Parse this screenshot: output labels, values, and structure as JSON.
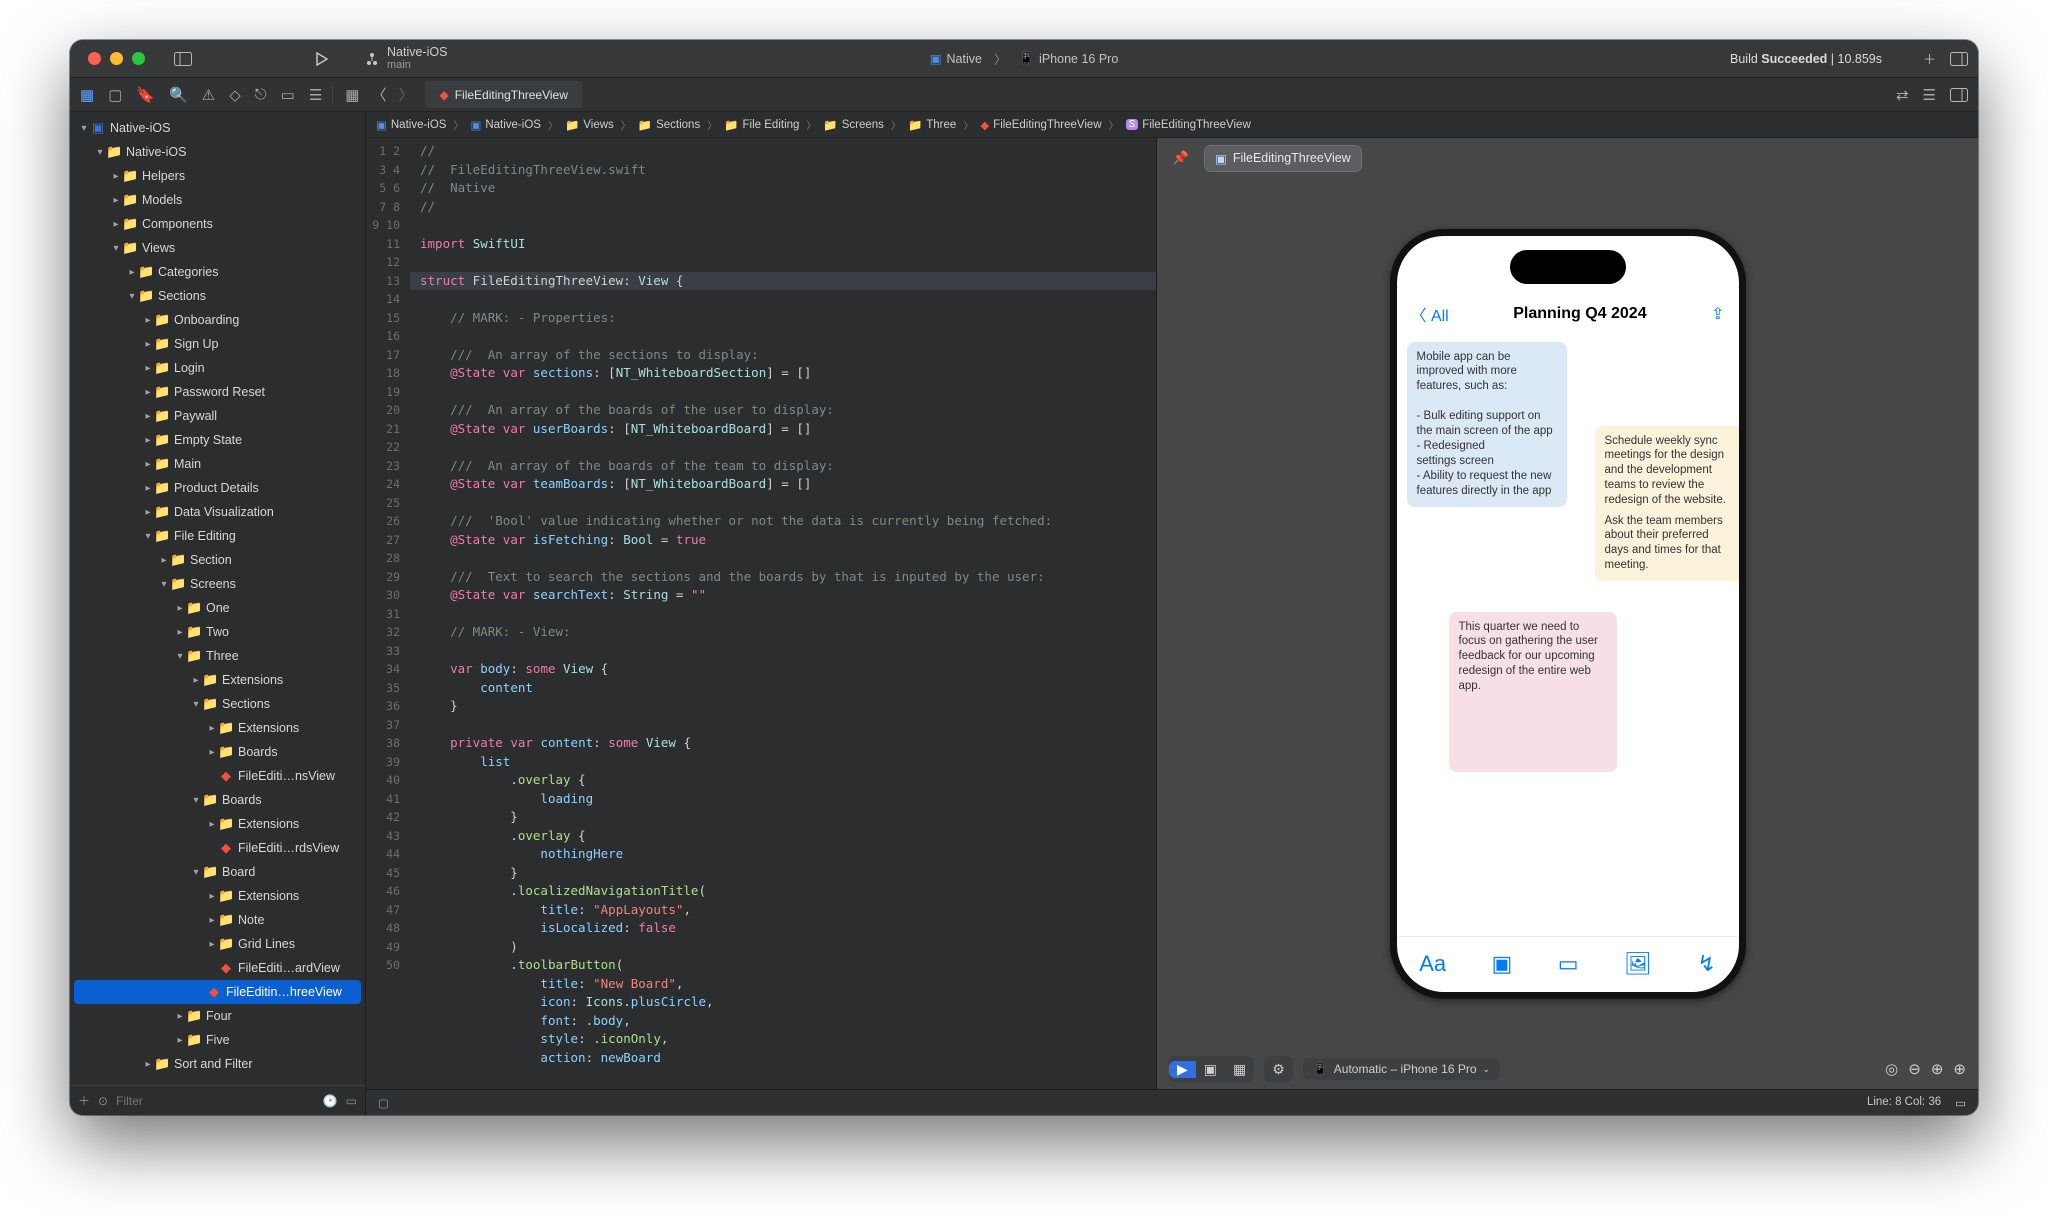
{
  "titlebar": {
    "scheme_name": "Native-iOS",
    "branch": "main",
    "target_app": "Native",
    "target_device": "iPhone 16 Pro",
    "build_prefix": "Build ",
    "build_status": "Succeeded",
    "build_time": " | 10.859s"
  },
  "tablabel": "FileEditingThreeView",
  "jump_bar": [
    "Native-iOS",
    "Native-iOS",
    "Views",
    "Sections",
    "File Editing",
    "Screens",
    "Three",
    "FileEditingThreeView",
    "FileEditingThreeView"
  ],
  "sidebar": {
    "filter_placeholder": "Filter",
    "tree": [
      {
        "d": 0,
        "i": "app",
        "disc": "v",
        "label": "Native-iOS"
      },
      {
        "d": 1,
        "i": "folder",
        "disc": "v",
        "label": "Native-iOS"
      },
      {
        "d": 2,
        "i": "folder",
        "disc": ">",
        "label": "Helpers"
      },
      {
        "d": 2,
        "i": "folder",
        "disc": ">",
        "label": "Models"
      },
      {
        "d": 2,
        "i": "folder",
        "disc": ">",
        "label": "Components"
      },
      {
        "d": 2,
        "i": "folder",
        "disc": "v",
        "label": "Views"
      },
      {
        "d": 3,
        "i": "folder",
        "disc": ">",
        "label": "Categories"
      },
      {
        "d": 3,
        "i": "folder",
        "disc": "v",
        "label": "Sections"
      },
      {
        "d": 4,
        "i": "folder",
        "disc": ">",
        "label": "Onboarding"
      },
      {
        "d": 4,
        "i": "folder",
        "disc": ">",
        "label": "Sign Up"
      },
      {
        "d": 4,
        "i": "folder",
        "disc": ">",
        "label": "Login"
      },
      {
        "d": 4,
        "i": "folder",
        "disc": ">",
        "label": "Password Reset"
      },
      {
        "d": 4,
        "i": "folder",
        "disc": ">",
        "label": "Paywall"
      },
      {
        "d": 4,
        "i": "folder",
        "disc": ">",
        "label": "Empty State"
      },
      {
        "d": 4,
        "i": "folder",
        "disc": ">",
        "label": "Main"
      },
      {
        "d": 4,
        "i": "folder",
        "disc": ">",
        "label": "Product Details"
      },
      {
        "d": 4,
        "i": "folder",
        "disc": ">",
        "label": "Data Visualization"
      },
      {
        "d": 4,
        "i": "folder",
        "disc": "v",
        "label": "File Editing"
      },
      {
        "d": 5,
        "i": "folder",
        "disc": ">",
        "label": "Section"
      },
      {
        "d": 5,
        "i": "folder",
        "disc": "v",
        "label": "Screens"
      },
      {
        "d": 6,
        "i": "folder",
        "disc": ">",
        "label": "One"
      },
      {
        "d": 6,
        "i": "folder",
        "disc": ">",
        "label": "Two"
      },
      {
        "d": 6,
        "i": "folder",
        "disc": "v",
        "label": "Three"
      },
      {
        "d": 7,
        "i": "folder",
        "disc": ">",
        "label": "Extensions"
      },
      {
        "d": 7,
        "i": "folder",
        "disc": "v",
        "label": "Sections"
      },
      {
        "d": 8,
        "i": "folder",
        "disc": ">",
        "label": "Extensions"
      },
      {
        "d": 8,
        "i": "folder",
        "disc": ">",
        "label": "Boards"
      },
      {
        "d": 8,
        "i": "swift",
        "disc": "",
        "label": "FileEditi…nsView"
      },
      {
        "d": 7,
        "i": "folder",
        "disc": "v",
        "label": "Boards"
      },
      {
        "d": 8,
        "i": "folder",
        "disc": ">",
        "label": "Extensions"
      },
      {
        "d": 8,
        "i": "swift",
        "disc": "",
        "label": "FileEditi…rdsView"
      },
      {
        "d": 7,
        "i": "folder",
        "disc": "v",
        "label": "Board"
      },
      {
        "d": 8,
        "i": "folder",
        "disc": ">",
        "label": "Extensions"
      },
      {
        "d": 8,
        "i": "folder",
        "disc": ">",
        "label": "Note"
      },
      {
        "d": 8,
        "i": "folder",
        "disc": ">",
        "label": "Grid Lines"
      },
      {
        "d": 8,
        "i": "swift",
        "disc": "",
        "label": "FileEditi…ardView"
      },
      {
        "d": 7,
        "i": "swift",
        "disc": "",
        "label": "FileEditin…hreeView",
        "selected": true
      },
      {
        "d": 6,
        "i": "folder",
        "disc": ">",
        "label": "Four"
      },
      {
        "d": 6,
        "i": "folder",
        "disc": ">",
        "label": "Five"
      },
      {
        "d": 4,
        "i": "folder",
        "disc": ">",
        "label": "Sort and Filter"
      }
    ]
  },
  "code_lines": [
    "//",
    "//  FileEditingThreeView.swift",
    "//  Native",
    "//",
    "",
    "import SwiftUI",
    "",
    "struct FileEditingThreeView: View {",
    "",
    "    // MARK: - Properties:",
    "",
    "    ///  An array of the sections to display:",
    "    @State var sections: [NT_WhiteboardSection] = []",
    "",
    "    ///  An array of the boards of the user to display:",
    "    @State var userBoards: [NT_WhiteboardBoard] = []",
    "",
    "    ///  An array of the boards of the team to display:",
    "    @State var teamBoards: [NT_WhiteboardBoard] = []",
    "",
    "    ///  'Bool' value indicating whether or not the data is currently being fetched:",
    "    @State var isFetching: Bool = true",
    "",
    "    ///  Text to search the sections and the boards by that is inputed by the user:",
    "    @State var searchText: String = \"\"",
    "",
    "    // MARK: - View:",
    "",
    "    var body: some View {",
    "        content",
    "    }",
    "",
    "    private var content: some View {",
    "        list",
    "            .overlay {",
    "                loading",
    "            }",
    "            .overlay {",
    "                nothingHere",
    "            }",
    "            .localizedNavigationTitle(",
    "                title: \"AppLayouts\",",
    "                isLocalized: false",
    "            )",
    "            .toolbarButton(",
    "                title: \"New Board\",",
    "                icon: Icons.plusCircle,",
    "                font: .body,",
    "                style: .iconOnly,",
    "                action: newBoard"
  ],
  "highlight_line_index": 7,
  "canvas": {
    "chip_label": "FileEditingThreeView",
    "device_label": "Automatic – iPhone 16 Pro"
  },
  "phone": {
    "back_label": "All",
    "title": "Planning Q4 2024",
    "notes": {
      "blue": "Mobile app can be improved with more features, such as:\n\n- Bulk editing support on the main screen of the app\n- Redesigned\nsettings screen\n- Ability to request the new features directly in the app",
      "yellow1": "Schedule weekly sync meetings for the design and the development teams to review the redesign of the website.",
      "yellow2": "Ask the team members about their preferred days and times for that meeting.",
      "pink": "This quarter we need to focus on gathering the user feedback for our upcoming redesign of the entire web app."
    }
  },
  "status": {
    "line_col": "Line: 8  Col: 36"
  }
}
